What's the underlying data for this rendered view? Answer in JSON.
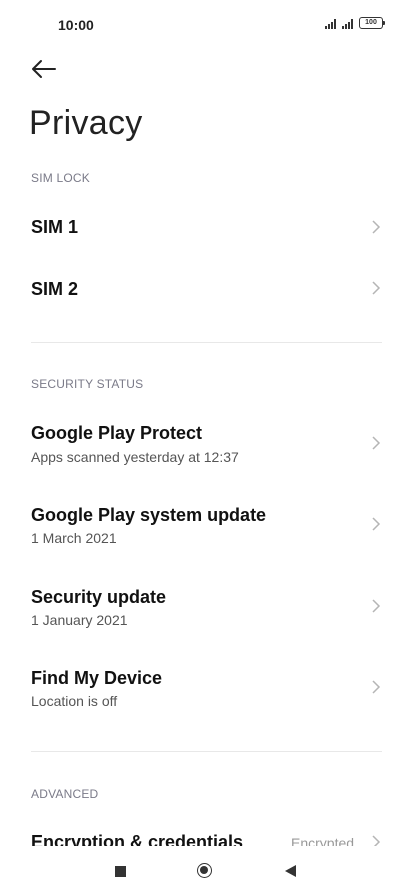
{
  "status_bar": {
    "time": "10:00",
    "battery": "100"
  },
  "header": {
    "back_icon": "arrow-left-icon",
    "title": "Privacy"
  },
  "sections": {
    "sim_lock": {
      "header": "SIM LOCK",
      "items": [
        {
          "title": "SIM 1"
        },
        {
          "title": "SIM 2"
        }
      ]
    },
    "security_status": {
      "header": "SECURITY STATUS",
      "items": [
        {
          "title": "Google Play Protect",
          "subtitle": "Apps scanned yesterday at 12:37"
        },
        {
          "title": "Google Play system update",
          "subtitle": "1 March 2021"
        },
        {
          "title": "Security update",
          "subtitle": "1 January 2021"
        },
        {
          "title": "Find My Device",
          "subtitle": "Location is off"
        }
      ]
    },
    "advanced": {
      "header": "ADVANCED",
      "items": [
        {
          "title": "Encryption & credentials",
          "value": "Encrypted"
        }
      ]
    }
  },
  "nav": {
    "icons": [
      "recents-square-icon",
      "home-circle-icon",
      "back-triangle-icon"
    ]
  },
  "colors": {
    "text": "#111111",
    "section_header": "#7a7a88",
    "subtitle": "#555555",
    "chevron": "#b5b5b5"
  }
}
